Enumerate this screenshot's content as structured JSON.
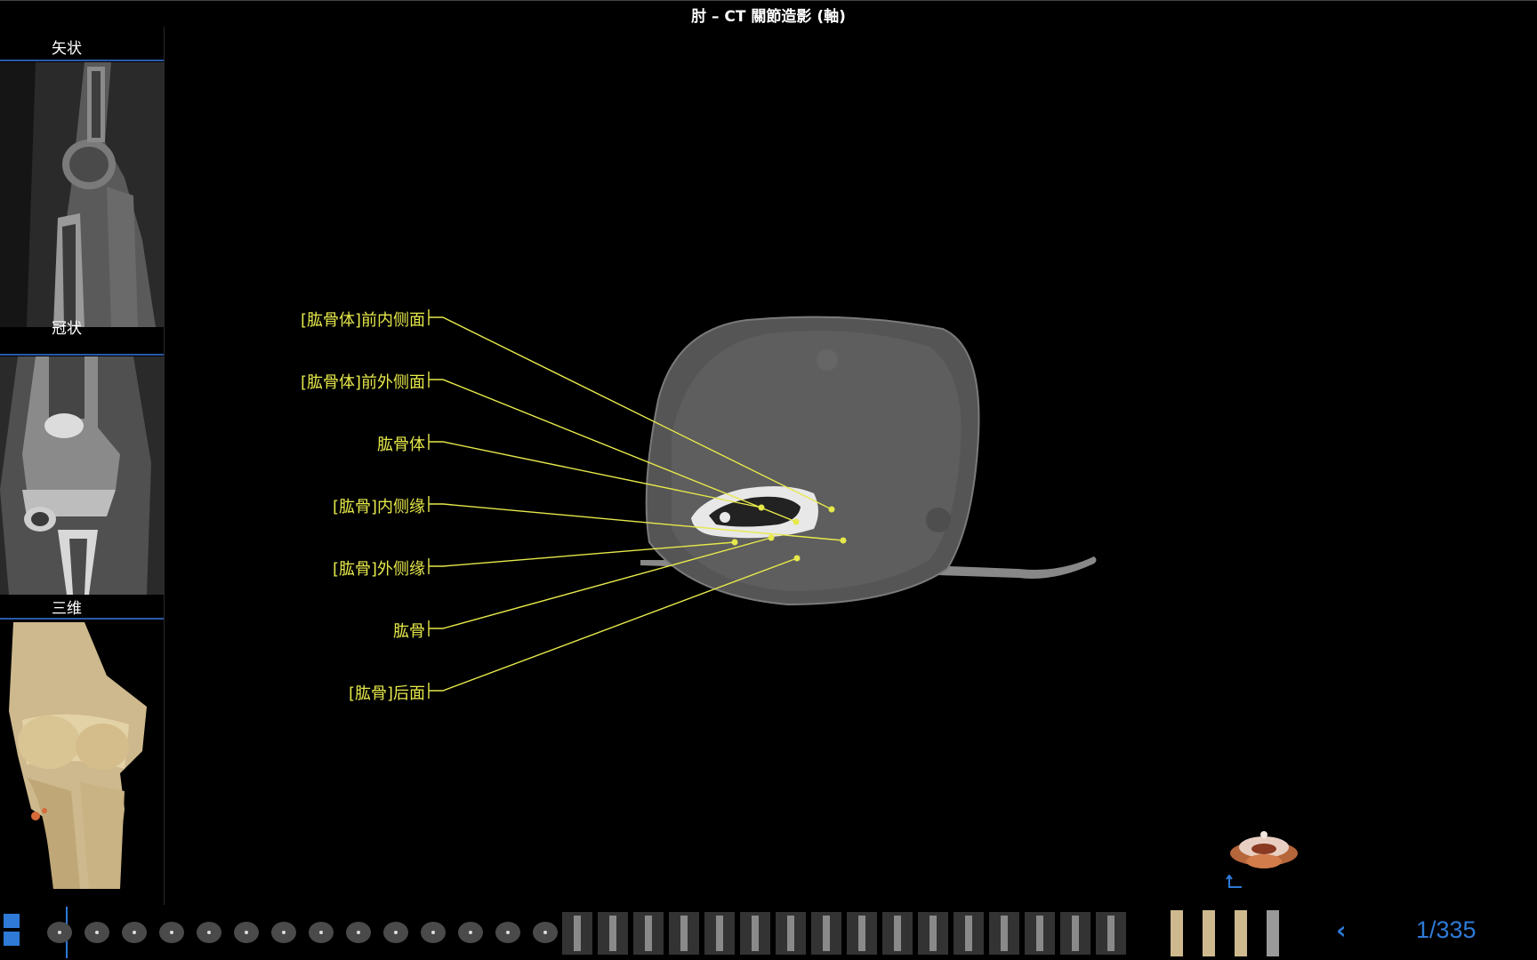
{
  "title": "肘 – CT 關節造影 (軸)",
  "sidebar": {
    "views": [
      {
        "label": "矢状"
      },
      {
        "label": "冠状"
      },
      {
        "label": "三维"
      }
    ]
  },
  "labels": [
    "[肱骨体]前内侧面",
    "[肱骨体]前外侧面",
    "肱骨体",
    "[肱骨]内侧缘",
    "[肱骨]外侧缘",
    "肱骨",
    "[肱骨]后面"
  ],
  "navigation": {
    "page_indicator": "1/335",
    "prev_symbol": "‹"
  },
  "colors": {
    "label": "#e6e94a",
    "accent": "#2e7ad6",
    "sidebar_rule": "#2a5aa8"
  },
  "icons": [
    "grid-view-icon",
    "axis-orientation-icon",
    "orientation-model-icon",
    "chevron-left-icon"
  ]
}
